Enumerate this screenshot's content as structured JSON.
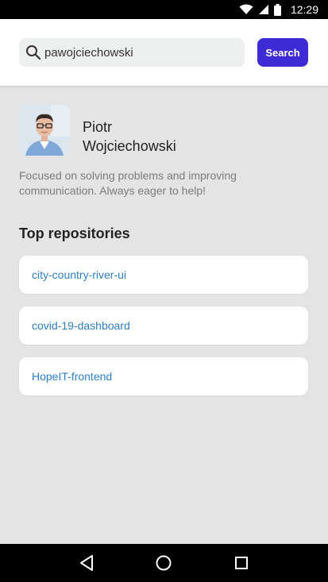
{
  "status_bar": {
    "time": "12:29"
  },
  "search": {
    "value": "pawojciechowski",
    "button_label": "Search"
  },
  "profile": {
    "first_name": "Piotr",
    "last_name": "Wojciechowski",
    "bio": "Focused on solving problems and improving communication. Always eager to help!"
  },
  "repositories": {
    "title": "Top repositories",
    "items": [
      {
        "name": "city-country-river-ui"
      },
      {
        "name": "covid-19-dashboard"
      },
      {
        "name": "HopeIT-frontend"
      }
    ]
  },
  "colors": {
    "accent": "#3d2bd6",
    "link": "#2f7fc4",
    "background": "#e4e4e4"
  },
  "icons": [
    "wifi-icon",
    "signal-icon",
    "battery-icon",
    "search-icon",
    "back-icon",
    "home-icon",
    "recents-icon"
  ]
}
